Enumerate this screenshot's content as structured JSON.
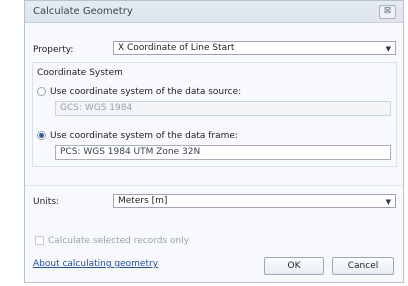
{
  "dialog": {
    "title": "Calculate Geometry",
    "close_glyph": "⊠"
  },
  "property": {
    "label": "Property:",
    "value": "X Coordinate of Line Start"
  },
  "coordinate_system": {
    "label": "Coordinate System",
    "options": [
      {
        "label": "Use coordinate system of the data source:",
        "value": "GCS: WGS 1984",
        "selected": false
      },
      {
        "label": "Use coordinate system of the data frame:",
        "value": "PCS: WGS 1984 UTM Zone 32N",
        "selected": true
      }
    ]
  },
  "units": {
    "label": "Units:",
    "value": "Meters [m]"
  },
  "selected_only": {
    "label": "Calculate selected records only",
    "checked": false
  },
  "footer": {
    "help_link": "About calculating geometry",
    "ok_label": "OK",
    "cancel_label": "Cancel"
  },
  "icons": {
    "dropdown": "chevron-down-icon",
    "close": "close-icon"
  }
}
